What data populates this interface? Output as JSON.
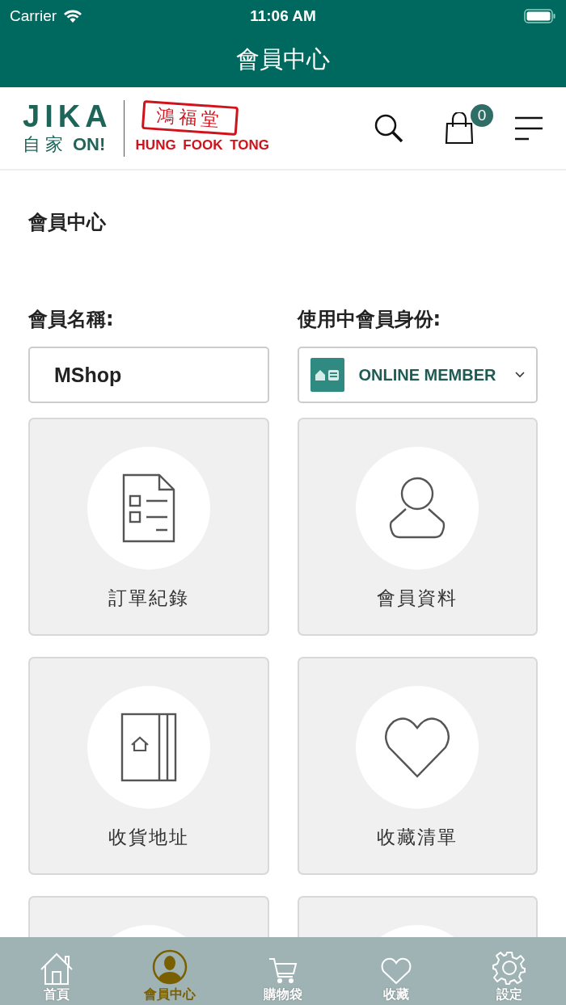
{
  "status_bar": {
    "carrier": "Carrier",
    "time": "11:06 AM"
  },
  "title": "會員中心",
  "header": {
    "logo": {
      "brand": "JIKA",
      "tagline_cn": "自家",
      "tagline_en": "ON!",
      "partner_cn": "鴻福堂",
      "partner_en": "HUNG FOOK TONG"
    },
    "cart_count": "0"
  },
  "section_title": "會員中心",
  "member_name": {
    "label": "會員名稱:",
    "value": "MShop"
  },
  "member_status": {
    "label": "使用中會員身份:",
    "value": "ONLINE MEMBER"
  },
  "tiles": [
    {
      "kind": "orders",
      "label": "訂單紀錄"
    },
    {
      "kind": "profile",
      "label": "會員資料"
    },
    {
      "kind": "address",
      "label": "收貨地址"
    },
    {
      "kind": "wishlist",
      "label": "收藏清單"
    },
    {
      "kind": "cut"
    },
    {
      "kind": "cut"
    }
  ],
  "tab_bar": [
    {
      "kind": "home",
      "label": "首頁",
      "selected": false
    },
    {
      "kind": "member",
      "label": "會員中心",
      "selected": true
    },
    {
      "kind": "cart",
      "label": "購物袋",
      "selected": false
    },
    {
      "kind": "heart",
      "label": "收藏",
      "selected": false
    },
    {
      "kind": "gear",
      "label": "設定",
      "selected": false
    }
  ]
}
